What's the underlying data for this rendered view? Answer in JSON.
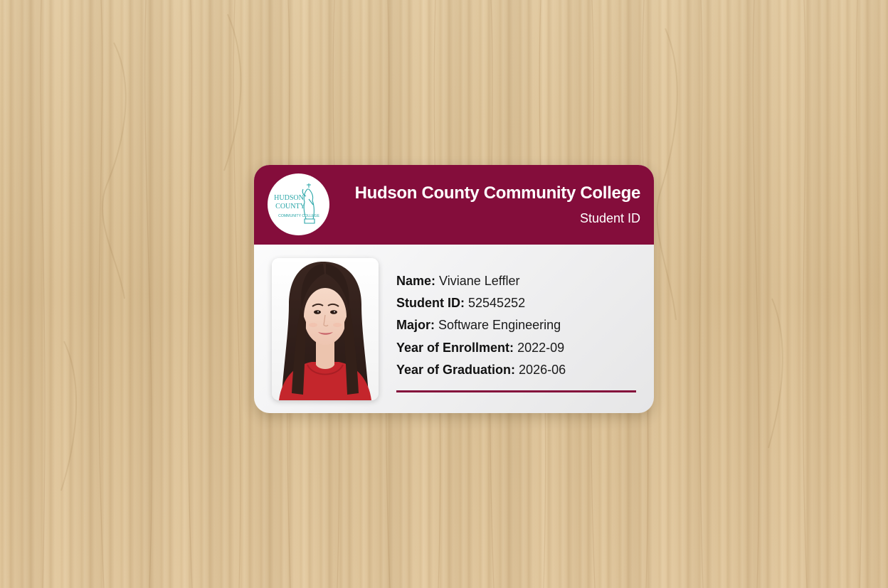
{
  "card": {
    "college_name": "Hudson County Community College",
    "card_type": "Student ID",
    "logo": {
      "lines": [
        "HUDSON",
        "COUNTY",
        "COMMUNITY COLLEGE"
      ],
      "emblem": "statue-of-liberty-icon"
    }
  },
  "student": {
    "fields": [
      {
        "label": "Name:",
        "value": "Viviane Leffler"
      },
      {
        "label": "Student ID:",
        "value": "52545252"
      },
      {
        "label": "Major:",
        "value": "Software Engineering"
      },
      {
        "label": "Year of Enrollment:",
        "value": "2022-09"
      },
      {
        "label": "Year of Graduation:",
        "value": "2026-06"
      }
    ]
  },
  "colors": {
    "brand": "#840d3b",
    "logo_teal": "#2aa6a8",
    "background": "#dcc39a"
  }
}
